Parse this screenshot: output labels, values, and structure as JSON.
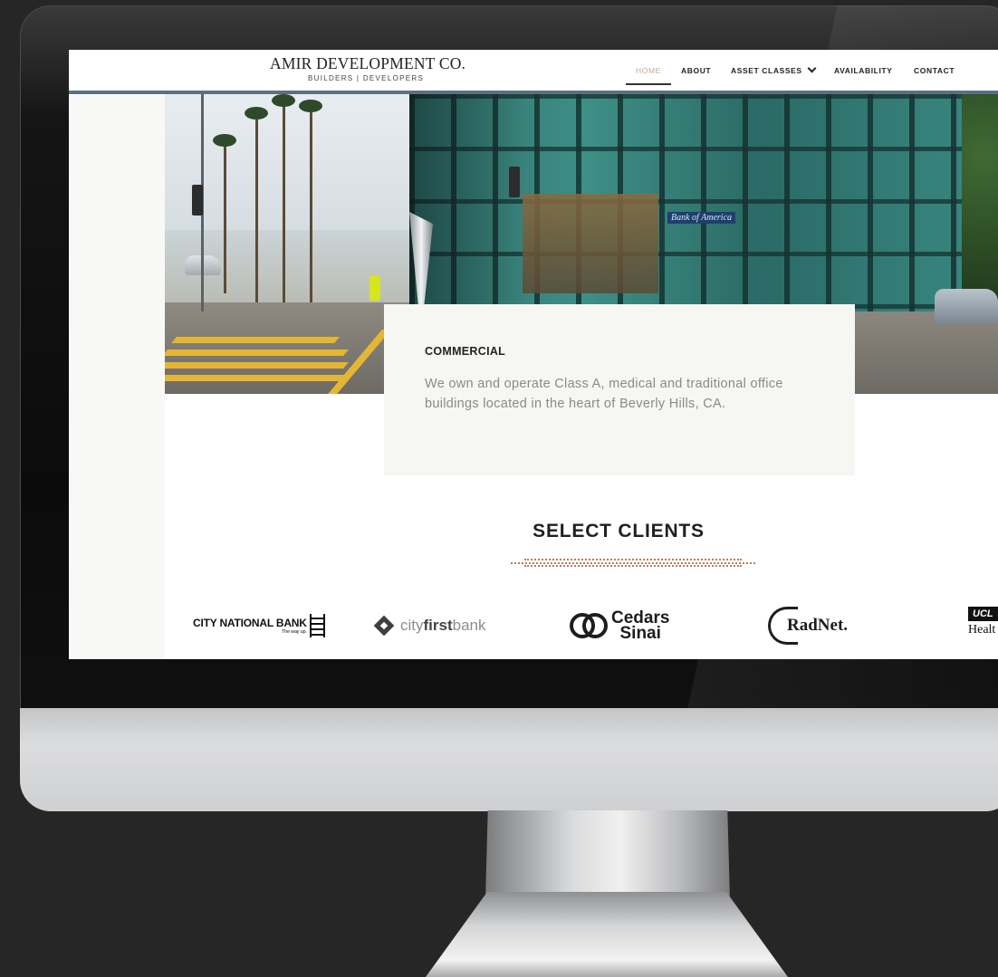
{
  "brand": {
    "title": "AMIR DEVELOPMENT CO.",
    "subtitle": "BUILDERS | DEVELOPERS"
  },
  "nav": {
    "items": [
      {
        "label": "HOME",
        "active": true
      },
      {
        "label": "ABOUT"
      },
      {
        "label": "ASSET CLASSES",
        "has_dropdown": true
      },
      {
        "label": "AVAILABILITY"
      },
      {
        "label": "CONTACT"
      }
    ]
  },
  "hero": {
    "photo_icon": "building-photo",
    "sign_text": "Bank of America"
  },
  "card": {
    "title": "COMMERCIAL",
    "body": "We own and operate Class A, medical and traditional office buildings located in the heart of Beverly Hills, CA."
  },
  "clients": {
    "title": "SELECT CLIENTS",
    "logos": {
      "city_national": {
        "name": "CITY NATIONAL BANK",
        "tagline": "The way up."
      },
      "cityfirst": {
        "part1": "city",
        "part2": "first",
        "part3": "bank"
      },
      "cedars": {
        "line1": "Cedars",
        "line2": "Sinai"
      },
      "radnet": {
        "name": "RadNet."
      },
      "ucla": {
        "line1": "UCL",
        "line2": "Healt"
      }
    }
  },
  "colors": {
    "nav_active": "#c7a98a",
    "nav_border": "#5d6f83",
    "rule_accent": "#b77e58",
    "card_bg": "#f6f6f2"
  }
}
